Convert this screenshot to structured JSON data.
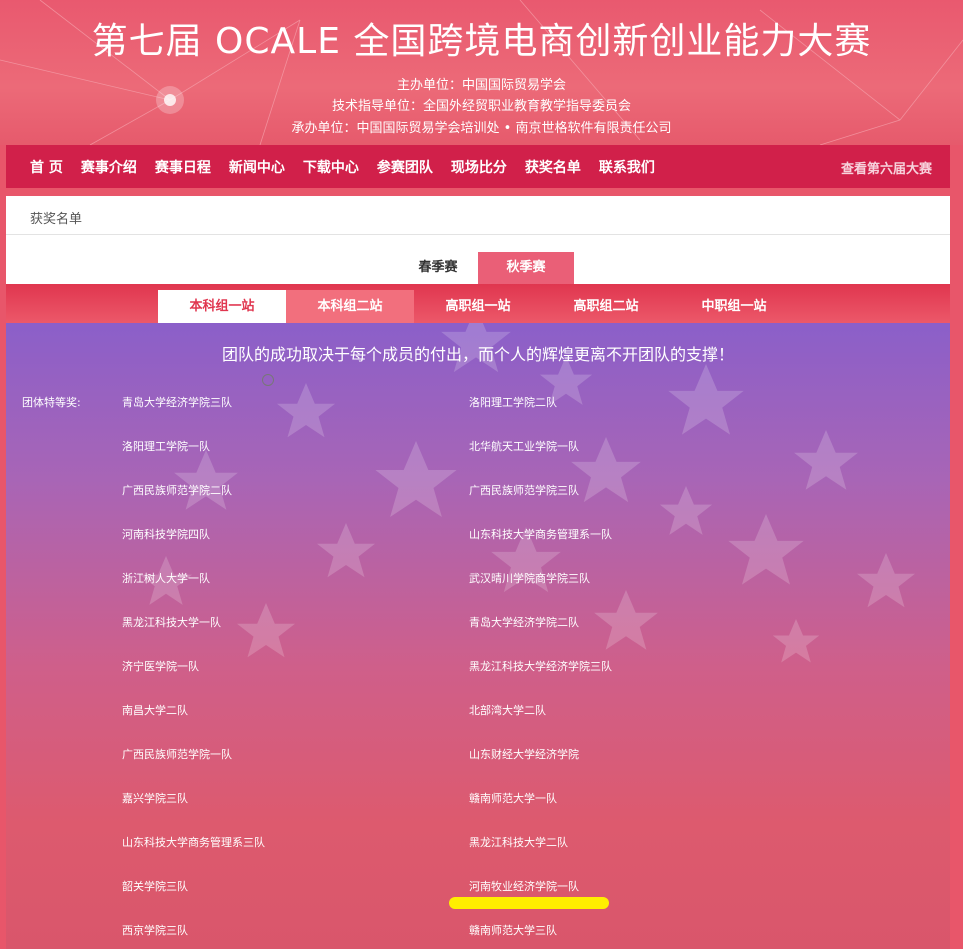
{
  "header": {
    "title": "第七届 OCALE 全国跨境电商创新创业能力大赛",
    "organizer": "主办单位：中国国际贸易学会",
    "tech_guidance": "技术指导单位：全国外经贸职业教育教学指导委员会",
    "host": "承办单位：中国国际贸易学会培训处 • 南京世格软件有限责任公司"
  },
  "nav": {
    "items": [
      "首 页",
      "赛事介绍",
      "赛事日程",
      "新闻中心",
      "下载中心",
      "参赛团队",
      "现场比分",
      "获奖名单",
      "联系我们"
    ],
    "right": "查看第六届大赛"
  },
  "breadcrumb": "获奖名单",
  "season_tabs": [
    "春季赛",
    "秋季赛"
  ],
  "group_tabs": [
    "本科组一站",
    "本科组二站",
    "高职组一站",
    "高职组二站",
    "中职组一站"
  ],
  "slogan": "团队的成功取决于每个成员的付出，而个人的辉煌更离不开团队的支撑！",
  "award_label": "团体特等奖:",
  "teams_left": [
    "青岛大学经济学院三队",
    "洛阳理工学院一队",
    "广西民族师范学院二队",
    "河南科技学院四队",
    "浙江树人大学一队",
    "黑龙江科技大学一队",
    "济宁医学院一队",
    "南昌大学二队",
    "广西民族师范学院一队",
    "嘉兴学院三队",
    "山东科技大学商务管理系三队",
    "韶关学院三队",
    "西京学院三队"
  ],
  "teams_right": [
    "洛阳理工学院二队",
    "北华航天工业学院一队",
    "广西民族师范学院三队",
    "山东科技大学商务管理系一队",
    "武汉晴川学院商学院三队",
    "青岛大学经济学院二队",
    "黑龙江科技大学经济学院三队",
    "北部湾大学二队",
    "山东财经大学经济学院",
    "赣南师范大学一队",
    "黑龙江科技大学二队",
    "河南牧业经济学院一队",
    "赣南师范大学三队"
  ],
  "colors": {
    "nav_bg": "#d1204a",
    "accent": "#e0364f",
    "highlight_marker": "#ffee00"
  }
}
